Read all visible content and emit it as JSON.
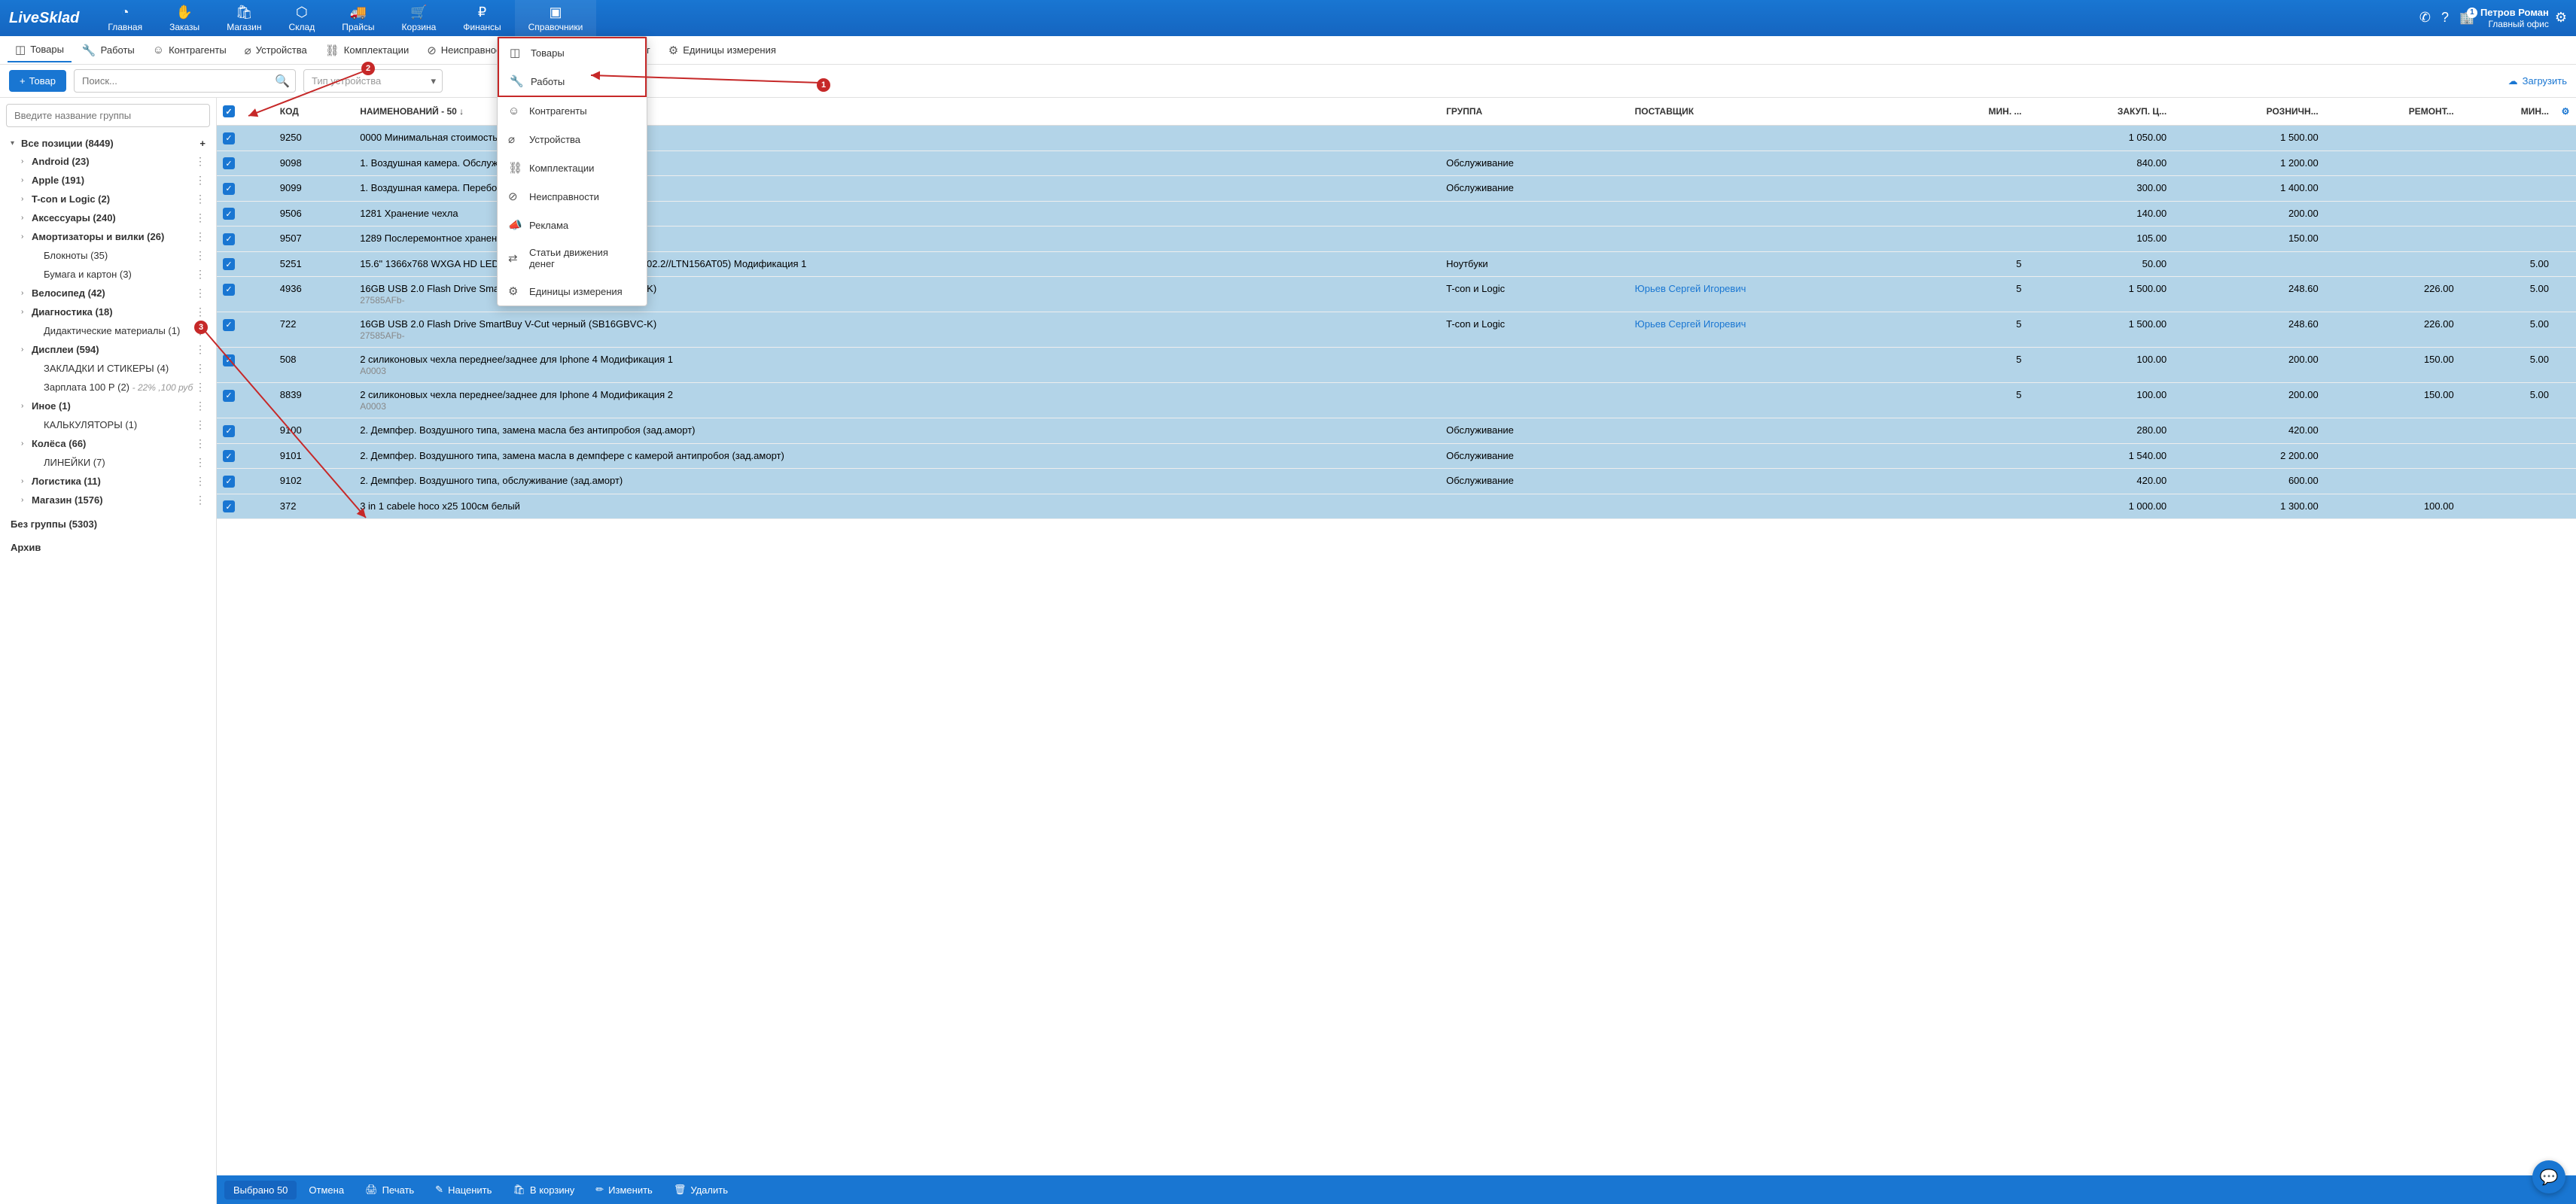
{
  "logo": "LiveSklad",
  "nav": [
    {
      "label": "Главная",
      "icon": "◔"
    },
    {
      "label": "Заказы",
      "icon": "✋"
    },
    {
      "label": "Магазин",
      "icon": "🛍"
    },
    {
      "label": "Склад",
      "icon": "⬡"
    },
    {
      "label": "Прайсы",
      "icon": "🚚"
    },
    {
      "label": "Корзина",
      "icon": "🛒"
    },
    {
      "label": "Финансы",
      "icon": "₽"
    },
    {
      "label": "Справочники",
      "icon": "▣",
      "active": true
    }
  ],
  "user": {
    "name": "Петров Роман",
    "office": "Главный офис",
    "badge": "1"
  },
  "tabs": [
    {
      "label": "Товары",
      "icon": "◫",
      "active": true
    },
    {
      "label": "Работы",
      "icon": "🔧"
    },
    {
      "label": "Контрагенты",
      "icon": "☺"
    },
    {
      "label": "Устройства",
      "icon": "⌀"
    },
    {
      "label": "Комплектации",
      "icon": "⛓"
    },
    {
      "label": "Неисправности",
      "icon": "⊘"
    },
    {
      "label": "Статьи движения денег",
      "icon": "⇄"
    },
    {
      "label": "Единицы измерения",
      "icon": "⚙"
    }
  ],
  "toolbar": {
    "add_btn": "Товар",
    "search_placeholder": "Поиск...",
    "device_type_placeholder": "Тип устройства",
    "upload": "Загрузить"
  },
  "sidebar": {
    "group_placeholder": "Введите название группы",
    "root": "Все позиции (8449)",
    "items": [
      {
        "label": "Android (23)",
        "bold": true,
        "chev": true
      },
      {
        "label": "Apple (191)",
        "bold": true,
        "chev": true
      },
      {
        "label": "T-con и Logic (2)",
        "bold": true,
        "chev": true
      },
      {
        "label": "Аксессуары (240)",
        "bold": true,
        "chev": true
      },
      {
        "label": "Амортизаторы и вилки (26)",
        "bold": true,
        "chev": true
      },
      {
        "label": "Блокноты (35)",
        "bold": false,
        "level": 2
      },
      {
        "label": "Бумага и картон (3)",
        "bold": false,
        "level": 2
      },
      {
        "label": "Велосипед (42)",
        "bold": true,
        "chev": true
      },
      {
        "label": "Диагностика (18)",
        "bold": true,
        "chev": true
      },
      {
        "label": "Дидактические материалы (1)",
        "bold": false,
        "level": 2
      },
      {
        "label": "Дисплеи (594)",
        "bold": true,
        "chev": true
      },
      {
        "label": "ЗАКЛАДКИ И СТИКЕРЫ (4)",
        "bold": false,
        "level": 2
      },
      {
        "label": "Зарплата 100 Р (2)",
        "extra": "- 22% ,100 руб",
        "bold": false,
        "level": 2
      },
      {
        "label": "Иное (1)",
        "bold": true,
        "chev": true
      },
      {
        "label": "КАЛЬКУЛЯТОРЫ (1)",
        "bold": false,
        "level": 2
      },
      {
        "label": "Колёса (66)",
        "bold": true,
        "chev": true
      },
      {
        "label": "ЛИНЕЙКИ (7)",
        "bold": false,
        "level": 2
      },
      {
        "label": "Логистика (11)",
        "bold": true,
        "chev": true
      },
      {
        "label": "Магазин (1576)",
        "bold": true,
        "chev": true
      }
    ],
    "no_group": "Без группы (5303)",
    "archive": "Архив"
  },
  "table": {
    "headers": [
      "",
      "КОД",
      "НАИМЕНОВАНИЙ - 50 ↓",
      "ГРУППА",
      "ПОСТАВЩИК",
      "МИН. ...",
      "ЗАКУП. Ц...",
      "РОЗНИЧН...",
      "РЕМОНТ...",
      "МИН..."
    ],
    "rows": [
      {
        "code": "9250",
        "name": "0000 Минимальная стоимость услуг (без учета ...)",
        "group": "",
        "supplier": "",
        "min": "",
        "buy": "1 050.00",
        "retail": "1 500.00",
        "repair": "",
        "minq": ""
      },
      {
        "code": "9098",
        "name": "1. Воздушная камера. Обслуживание (зад.аморт...)",
        "group": "Обслуживание",
        "supplier": "",
        "min": "",
        "buy": "840.00",
        "retail": "1 200.00",
        "repair": "",
        "minq": ""
      },
      {
        "code": "9099",
        "name": "1. Воздушная камера. Переборка нестандартно...",
        "group": "Обслуживание",
        "supplier": "",
        "min": "",
        "buy": "300.00",
        "retail": "1 400.00",
        "repair": "",
        "minq": ""
      },
      {
        "code": "9506",
        "name": "1281 Хранение чехла",
        "group": "",
        "supplier": "",
        "min": "",
        "buy": "140.00",
        "retail": "200.00",
        "repair": "",
        "minq": ""
      },
      {
        "code": "9507",
        "name": "1289 Послеремонтное хранение (за сутки)",
        "group": "",
        "supplier": "",
        "min": "",
        "buy": "105.00",
        "retail": "150.00",
        "repair": "",
        "minq": ""
      },
      {
        "code": "5251",
        "name": "15.6\" 1366x768 WXGA HD LED Глянцевый 40pin (L0B/B156XTN02.2//LTN156AT05) Модификация 1",
        "group": "Ноутбуки",
        "supplier": "",
        "min": "5",
        "buy": "50.00",
        "retail": "",
        "repair": "",
        "minq": "5.00"
      },
      {
        "code": "4936",
        "name": "16GB USB 2.0 Flash Drive SmartBuy V-Cut черный (SB16GBVC-K)",
        "sub": "27585AFb-",
        "group": "T-con и Logic",
        "supplier": "Юрьев Сергей Игоревич",
        "supplier_link": true,
        "min": "5",
        "buy": "1 500.00",
        "retail": "248.60",
        "repair": "226.00",
        "minq": "5.00"
      },
      {
        "code": "722",
        "name": "16GB USB 2.0 Flash Drive SmartBuy V-Cut черный (SB16GBVC-K)",
        "sub": "27585AFb-",
        "group": "T-con и Logic",
        "supplier": "Юрьев Сергей Игоревич",
        "supplier_link": true,
        "min": "5",
        "buy": "1 500.00",
        "retail": "248.60",
        "repair": "226.00",
        "minq": "5.00"
      },
      {
        "code": "508",
        "name": "2 силиконовых чехла переднее/заднее для Iphone 4 Модификация 1",
        "sub": "A0003",
        "group": "",
        "supplier": "",
        "min": "5",
        "buy": "100.00",
        "retail": "200.00",
        "repair": "150.00",
        "minq": "5.00"
      },
      {
        "code": "8839",
        "name": "2 силиконовых чехла переднее/заднее для Iphone 4 Модификация 2",
        "sub": "A0003",
        "group": "",
        "supplier": "",
        "min": "5",
        "buy": "100.00",
        "retail": "200.00",
        "repair": "150.00",
        "minq": "5.00"
      },
      {
        "code": "9100",
        "name": "2. Демпфер. Воздушного типа, замена масла без антипробоя (зад.аморт)",
        "group": "Обслуживание",
        "supplier": "",
        "min": "",
        "buy": "280.00",
        "retail": "420.00",
        "repair": "",
        "minq": ""
      },
      {
        "code": "9101",
        "name": "2. Демпфер. Воздушного типа, замена масла в демпфере с камерой антипробоя (зад.аморт)",
        "group": "Обслуживание",
        "supplier": "",
        "min": "",
        "buy": "1 540.00",
        "retail": "2 200.00",
        "repair": "",
        "minq": ""
      },
      {
        "code": "9102",
        "name": "2. Демпфер. Воздушного типа, обслуживание (зад.аморт)",
        "group": "Обслуживание",
        "supplier": "",
        "min": "",
        "buy": "420.00",
        "retail": "600.00",
        "repair": "",
        "minq": ""
      },
      {
        "code": "372",
        "name": "3 in 1 cabele hoco x25 100см белый",
        "group": "",
        "supplier": "",
        "min": "",
        "buy": "1 000.00",
        "retail": "1 300.00",
        "repair": "100.00",
        "minq": ""
      }
    ]
  },
  "footer": {
    "selected": "Выбрано 50",
    "cancel": "Отмена",
    "print": "Печать",
    "markup": "Наценить",
    "cart": "В корзину",
    "edit": "Изменить",
    "delete": "Удалить"
  },
  "dropdown": {
    "items": [
      {
        "label": "Товары",
        "icon": "◫"
      },
      {
        "label": "Работы",
        "icon": "🔧"
      },
      {
        "label": "Контрагенты",
        "icon": "☺"
      },
      {
        "label": "Устройства",
        "icon": "⌀"
      },
      {
        "label": "Комплектации",
        "icon": "⛓"
      },
      {
        "label": "Неисправности",
        "icon": "⊘"
      },
      {
        "label": "Реклама",
        "icon": "📣"
      },
      {
        "label": "Статьи движения денег",
        "icon": "⇄"
      },
      {
        "label": "Единицы измерения",
        "icon": "⚙"
      }
    ]
  },
  "annotations": {
    "a1": "1",
    "a2": "2",
    "a3": "3"
  }
}
